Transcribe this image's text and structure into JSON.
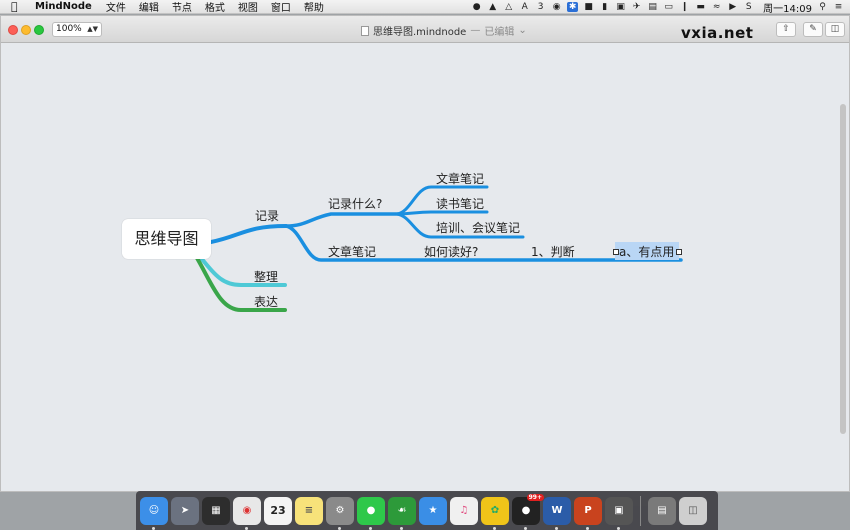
{
  "menubar": {
    "app_name": "MindNode",
    "menus": [
      "文件",
      "编辑",
      "节点",
      "格式",
      "视图",
      "窗口",
      "帮助"
    ],
    "status_number": "3",
    "clock": "周一14:09"
  },
  "window": {
    "zoom": "100%",
    "title": "思维导图.mindnode",
    "title_separator": "—",
    "title_state": "已编辑",
    "watermark": "vxia.net"
  },
  "mindmap": {
    "root": "思维导图",
    "colors": {
      "branch_blue": "#1a8fe0",
      "branch_teal": "#4ec9d6",
      "branch_green": "#3aa64a",
      "selection": "#b9d6f5"
    },
    "branches": {
      "record": "记录",
      "record_what": "记录什么?",
      "article_notes_1": "文章笔记",
      "reading_notes": "读书笔记",
      "training_notes": "培训、会议笔记",
      "article_notes_2": "文章笔记",
      "how_to_read": "如何读好?",
      "judge": "1、判断",
      "useful": "a、有点用",
      "organize": "整理",
      "express": "表达"
    }
  },
  "dock": {
    "calendar_day": "23",
    "qq_badge": "99+",
    "word_label": "W",
    "ppt_label": "P"
  }
}
